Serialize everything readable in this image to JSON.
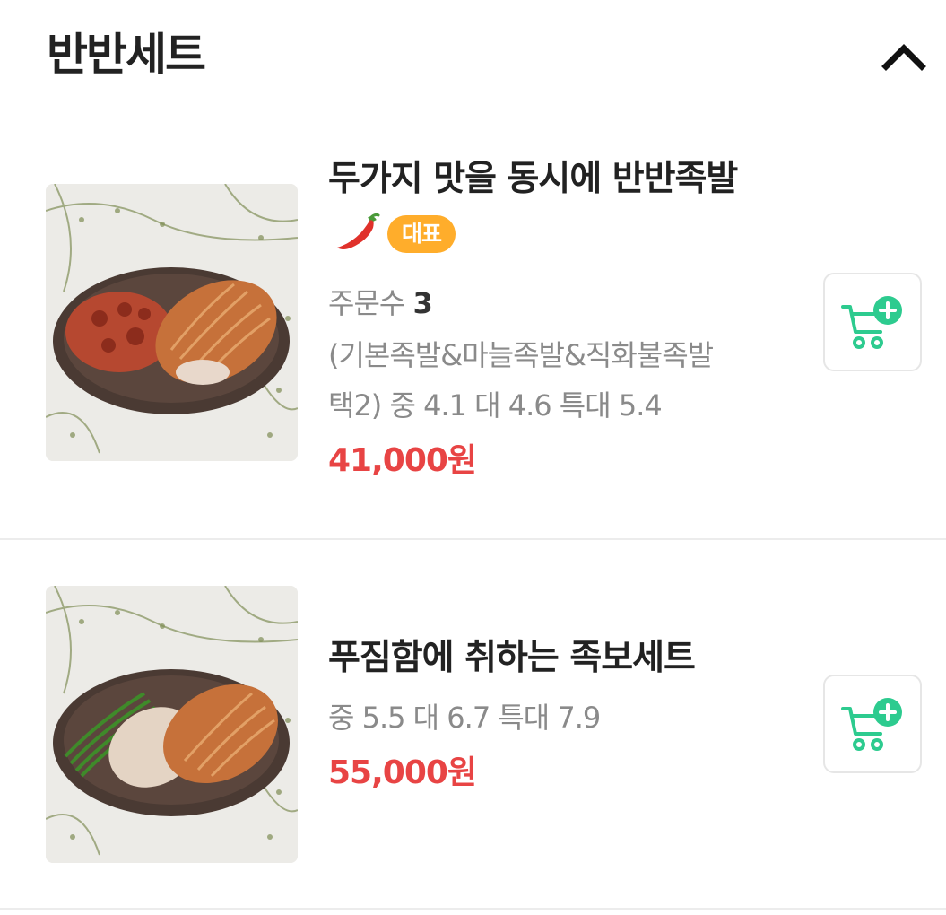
{
  "section": {
    "title": "반반세트",
    "collapse_icon": "chevron-up-icon"
  },
  "items": [
    {
      "name": "두가지 맛을 동시에 반반족발",
      "spicy_icon": "chili-pepper-icon",
      "badge": "대표",
      "order_count_label": "주문수",
      "order_count": "3",
      "description": "(기본족발&마늘족발&직화불족발 택2) 중 4.1 대 4.6 특대 5.4",
      "price": "41,000원",
      "cart_icon": "add-to-cart-icon"
    },
    {
      "name": "푸짐함에 취하는 족보세트",
      "description": "중 5.5 대 6.7 특대 7.9",
      "price": "55,000원",
      "cart_icon": "add-to-cart-icon"
    }
  ],
  "colors": {
    "price": "#e84444",
    "badge": "#ffad2b",
    "cart_accent": "#2dcb8f"
  }
}
